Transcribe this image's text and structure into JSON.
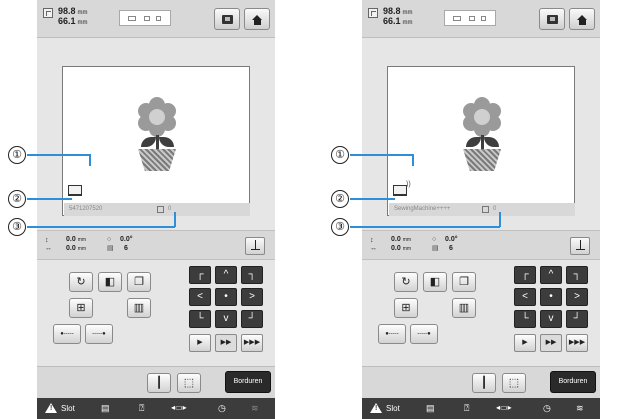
{
  "callouts": [
    "①",
    "②",
    "③"
  ],
  "screens": [
    {
      "dim_w": "98.8",
      "dim_h": "66.1",
      "unit": "mm",
      "machine_name": "5471207520",
      "needle_count": "0",
      "stat_x": "0.0",
      "stat_y": "0.0",
      "stat_unit": "mm",
      "stat_angle": "0.0°",
      "stat_count": "6",
      "embroider_label": "Borduren",
      "slot_label": "Slot",
      "wifi_connected": false
    },
    {
      "dim_w": "98.8",
      "dim_h": "66.1",
      "unit": "mm",
      "machine_name": "SewingMachine++++",
      "needle_count": "0",
      "stat_x": "0.0",
      "stat_y": "0.0",
      "stat_unit": "mm",
      "stat_angle": "0.0°",
      "stat_count": "6",
      "embroider_label": "Borduren",
      "slot_label": "Slot",
      "wifi_connected": true
    }
  ],
  "icons": {
    "rotate": "↻",
    "dpad_center": "•",
    "speed_play": "▶",
    "speed_fast": "▶▶",
    "speed_faster": "▶▶▶"
  },
  "colors": {
    "callout": "#2d8ed9",
    "embroider_button": "#2a2a2a"
  }
}
